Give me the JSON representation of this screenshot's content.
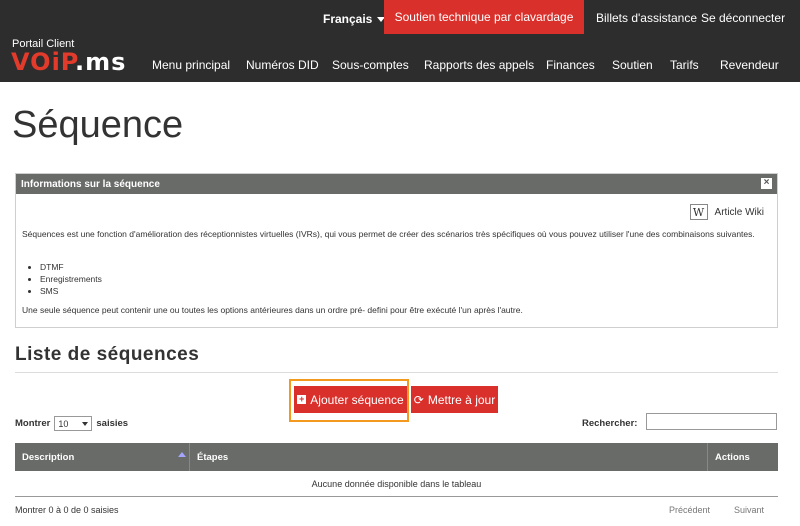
{
  "header": {
    "language": "Français",
    "support_button": "Soutien technique par clavardage",
    "links": [
      "Billets d'assistance",
      "Se déconnecter"
    ],
    "logo_subtitle": "Portail Client",
    "logo_prefix": "VO",
    "logo_mid": "iP",
    "logo_suffix": ".ms",
    "nav": [
      "Menu principal",
      "Numéros DID",
      "Sous-comptes",
      "Rapports des appels",
      "Finances",
      "Soutien",
      "Tarifs",
      "Revendeur"
    ]
  },
  "page": {
    "title": "Séquence"
  },
  "info_panel": {
    "title": "Informations sur la séquence",
    "close_glyph": "×",
    "wiki_glyph": "W",
    "wiki_label": "Article Wiki",
    "description": "Séquences est une fonction d'amélioration des réceptionnistes virtuelles (IVRs), qui vous permet de créer des scénarios très spécifiques où vous pouvez utiliser l'une des combinaisons suivantes.",
    "items": [
      "DTMF",
      "Enregistrements",
      "SMS"
    ],
    "footer_text": "Une seule séquence peut contenir une ou toutes les options antérieures dans un ordre pré- defini pour être exécuté l'un après l'autre."
  },
  "list": {
    "title": "Liste de séquences",
    "add_button": "Ajouter séquence",
    "add_icon": "+",
    "refresh_button": "Mettre à jour",
    "refresh_icon": "⟳",
    "show_label": "Montrer",
    "show_value": "10",
    "entries_label": "saisies",
    "search_label": "Rechercher:",
    "search_value": "",
    "columns": [
      "Description",
      "Étapes",
      "Actions"
    ],
    "empty_message": "Aucune donnée disponible dans le tableau",
    "info_text": "Montrer 0 à 0 de 0 saisies",
    "previous": "Précédent",
    "next": "Suivant"
  },
  "colors": {
    "header_bg": "#2d2d2d",
    "accent_red": "#d9302b",
    "panel_header": "#686b68",
    "highlight": "#f39a1e"
  }
}
